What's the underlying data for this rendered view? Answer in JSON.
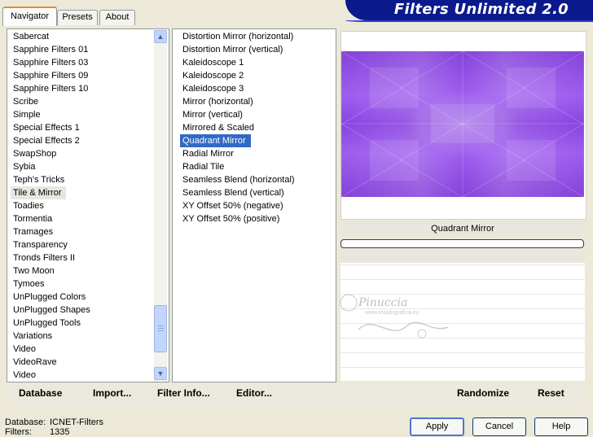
{
  "header": {
    "title": "Filters Unlimited 2.0"
  },
  "tabs": [
    {
      "label": "Navigator",
      "active": true
    },
    {
      "label": "Presets",
      "active": false
    },
    {
      "label": "About",
      "active": false
    }
  ],
  "categories": [
    "Sabercat",
    "Sapphire Filters 01",
    "Sapphire Filters 03",
    "Sapphire Filters 09",
    "Sapphire Filters 10",
    "Scribe",
    "Simple",
    "Special Effects 1",
    "Special Effects 2",
    "SwapShop",
    "Sybia",
    "Teph's Tricks",
    "Tile & Mirror",
    "Toadies",
    "Tormentia",
    "Tramages",
    "Transparency",
    "Tronds Filters II",
    "Two Moon",
    "Tymoes",
    "UnPlugged Colors",
    "UnPlugged Shapes",
    "UnPlugged Tools",
    "Variations",
    "Video",
    "VideoRave",
    "Video"
  ],
  "selected_category": "Tile & Mirror",
  "filters": [
    "Distortion Mirror (horizontal)",
    "Distortion Mirror (vertical)",
    "Kaleidoscope 1",
    "Kaleidoscope 2",
    "Kaleidoscope 3",
    "Mirror (horizontal)",
    "Mirror (vertical)",
    "Mirrored & Scaled",
    "Quadrant Mirror",
    "Radial Mirror",
    "Radial Tile",
    "Seamless Blend (horizontal)",
    "Seamless Blend (vertical)",
    "XY Offset 50% (negative)",
    "XY Offset 50% (positive)"
  ],
  "selected_filter": "Quadrant Mirror",
  "preview": {
    "filter_name": "Quadrant Mirror",
    "color": "#9046ec"
  },
  "toolbar": {
    "database": "Database",
    "import": "Import...",
    "filter_info": "Filter Info...",
    "editor": "Editor...",
    "randomize": "Randomize",
    "reset": "Reset"
  },
  "status": {
    "database_label": "Database:",
    "database_value": "ICNET-Filters",
    "filters_label": "Filters:",
    "filters_value": "1335"
  },
  "buttons": {
    "apply": "Apply",
    "cancel": "Cancel",
    "help": "Help"
  },
  "watermark": {
    "name": "Pinuccia",
    "url": "www.maidirgrafica.eu"
  }
}
